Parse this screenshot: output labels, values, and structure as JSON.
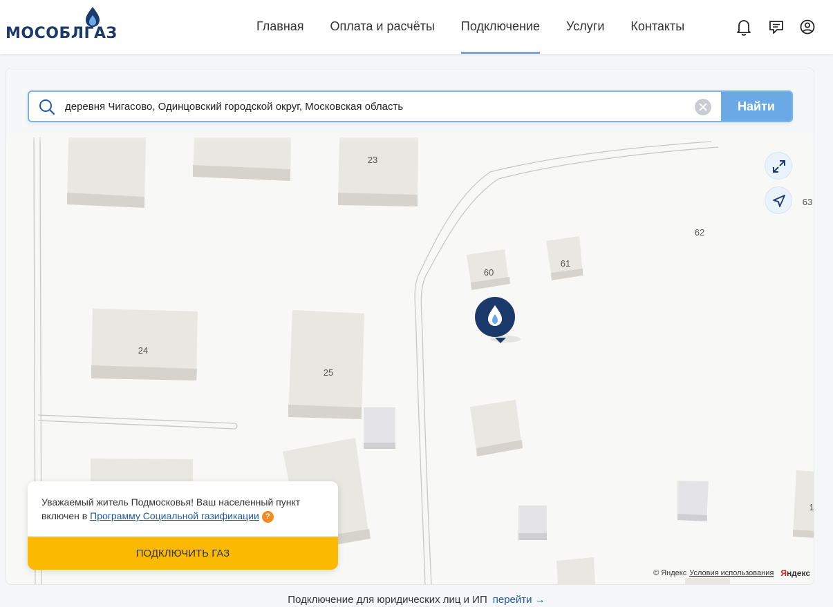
{
  "header": {
    "logo_text": "МОСОБЛГАЗ",
    "nav": [
      {
        "label": "Главная"
      },
      {
        "label": "Оплата и расчёты"
      },
      {
        "label": "Подключение"
      },
      {
        "label": "Услуги"
      },
      {
        "label": "Контакты"
      }
    ],
    "active_nav": "Подключение",
    "icons": [
      "bell-icon",
      "chat-icon",
      "user-icon"
    ]
  },
  "search": {
    "value": "деревня Чигасово, Одинцовский городской округ, Московская область",
    "button_label": "Найти"
  },
  "map": {
    "house_labels": [
      "23",
      "63",
      "62",
      "60",
      "61",
      "24",
      "25",
      "1"
    ],
    "marker_icon": "gas-flame-pin-icon",
    "controls": [
      "expand-icon",
      "locate-arrow-icon"
    ]
  },
  "notice": {
    "text": "Уважаемый житель Подмосковья! Ваш населенный пункт включен в",
    "link": "Программу Социальной газификации",
    "help_badge": "?",
    "button_label": "ПОДКЛЮЧИТЬ ГАЗ"
  },
  "attribution": {
    "copyright": "© Яндекс",
    "terms": "Условия использования",
    "brand_first": "Я",
    "brand_rest": "ндекс"
  },
  "footer": {
    "text": "Подключение для юридических лиц и ИП",
    "link": "перейти →"
  },
  "colors": {
    "brand": "#1b3a6b",
    "accent": "#6aa8e6",
    "cta": "#fbb900",
    "link": "#1f5aa6",
    "help": "#f28c1e"
  }
}
